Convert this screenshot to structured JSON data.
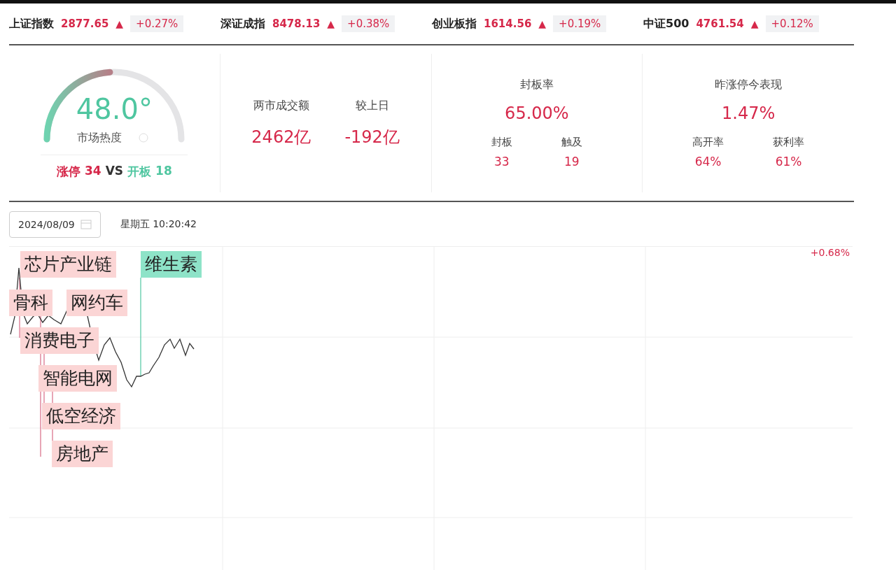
{
  "indices": [
    {
      "name": "上证指数",
      "value": "2877.65",
      "arrow": "▲",
      "change": "+0.27%"
    },
    {
      "name": "深证成指",
      "value": "8478.13",
      "arrow": "▲",
      "change": "+0.38%"
    },
    {
      "name": "创业板指",
      "value": "1614.56",
      "arrow": "▲",
      "change": "+0.19%"
    },
    {
      "name": "中证500",
      "value": "4761.54",
      "arrow": "▲",
      "change": "+0.12%"
    }
  ],
  "heat": {
    "value": "48.0°",
    "label": "市场热度",
    "level": 0.48,
    "limit_up_label": "涨停",
    "limit_up": "34",
    "vs": "VS",
    "opened_label": "开板",
    "opened": "18"
  },
  "turnover": {
    "columns": [
      {
        "label": "两市成交额",
        "value": "2462亿"
      },
      {
        "label": "较上日",
        "value": "-192亿"
      }
    ]
  },
  "seal_rate": {
    "title": "封板率",
    "value": "65.00%",
    "items": [
      {
        "label": "封板",
        "value": "33"
      },
      {
        "label": "触及",
        "value": "19"
      }
    ]
  },
  "yesterday": {
    "title": "昨涨停今表现",
    "value": "1.47%",
    "items": [
      {
        "label": "高开率",
        "value": "64%"
      },
      {
        "label": "获利率",
        "value": "61%"
      }
    ]
  },
  "date_field": {
    "value": "2024/08/09"
  },
  "datetime": "星期五 10:20:42",
  "chart": {
    "top_right_label": "+0.68%",
    "tags": [
      {
        "label": "芯片产业链",
        "color": "#fbd5d5"
      },
      {
        "label": "维生素",
        "color": "#8ee3c8"
      },
      {
        "label": "骨科",
        "color": "#fbd5d5"
      },
      {
        "label": "网约车",
        "color": "#fbd5d5"
      },
      {
        "label": "消费电子",
        "color": "#fbd5d5"
      },
      {
        "label": "智能电网",
        "color": "#fbd5d5"
      },
      {
        "label": "低空经济",
        "color": "#fbd5d5"
      },
      {
        "label": "房地产",
        "color": "#fbd5d5"
      }
    ]
  }
}
